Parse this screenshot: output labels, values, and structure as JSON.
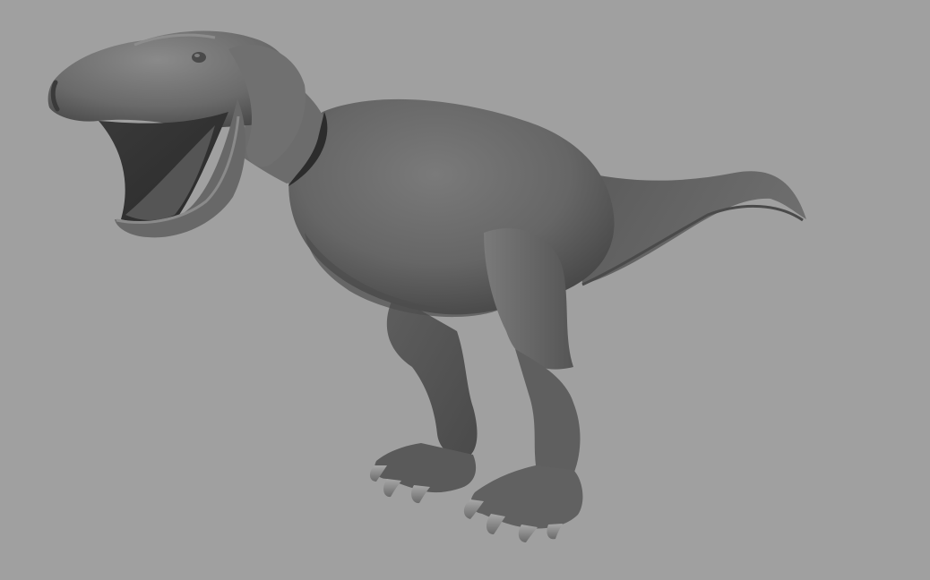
{
  "viewport": {
    "background": "#a0a0a0"
  },
  "model": {
    "subject": "tyrannosaurus-rex",
    "pose": "standing-roaring",
    "facing": "left",
    "shading": "smooth-gray-clay",
    "colors": {
      "base": "#6b6b6b",
      "highlight": "#8c8c8c",
      "shadow": "#3c3c3c",
      "deep": "#262626",
      "claw": "#9a9a9a"
    }
  }
}
